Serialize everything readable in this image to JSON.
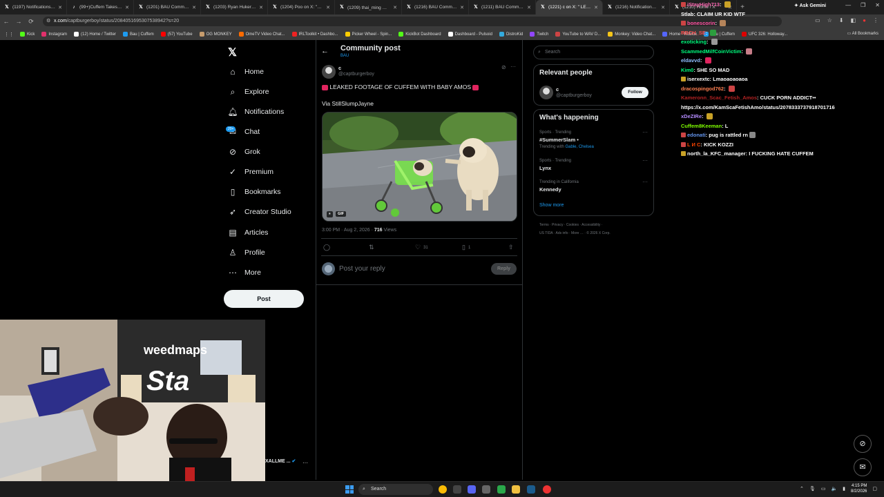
{
  "browser": {
    "tabs": [
      {
        "title": "(1197) Notifications / X",
        "icon": "x-icon",
        "active": false
      },
      {
        "title": "(99+)Cuffem Takes Brea",
        "icon": "tiktok-icon",
        "active": false
      },
      {
        "title": "(1201) BAU Community",
        "icon": "x-icon",
        "active": false
      },
      {
        "title": "(1203) Ryan Hukery on",
        "icon": "x-icon",
        "active": false
      },
      {
        "title": "(1204) Poo on X: \"http",
        "icon": "x-icon",
        "active": false
      },
      {
        "title": "(1209) thai_ming 🍋 on",
        "icon": "x-icon",
        "active": false
      },
      {
        "title": "(1216) BAU Community",
        "icon": "x-icon",
        "active": false
      },
      {
        "title": "(1211) BAU Community",
        "icon": "x-icon",
        "active": false
      },
      {
        "title": "(1221) c on X: \" LEAK",
        "icon": "x-icon",
        "active": true
      },
      {
        "title": "(1216) Notifications / X",
        "icon": "x-icon",
        "active": false
      },
      {
        "title": "(1210) Home / X",
        "icon": "x-icon",
        "active": false
      }
    ],
    "new_tab": "+",
    "ask_gemini": "Ask Gemini",
    "url_host": "x.com",
    "url_path": "/captburgerboy/status/2084051695307538942?s=20",
    "bookmarks": [
      {
        "label": "Kick",
        "color": "#53fc18"
      },
      {
        "label": "Instagram",
        "color": "#e1306c"
      },
      {
        "label": "(12) Home / Twitter",
        "color": "#ffffff"
      },
      {
        "label": "Bau | Cuffem",
        "color": "#1d9bf0"
      },
      {
        "label": "(57) YouTube",
        "color": "#ff0000"
      },
      {
        "label": "OG MONKEY",
        "color": "#c69c6d"
      },
      {
        "label": "OmeTV Video Chat...",
        "color": "#ff6b00"
      },
      {
        "label": "IRLToolkit • Dashbo...",
        "color": "#e22"
      },
      {
        "label": "Picker Wheel - Spin...",
        "color": "#ffcc00"
      },
      {
        "label": "KickBot Dashboard",
        "color": "#53fc18"
      },
      {
        "label": "Dashboard - Pulsoid",
        "color": "#ffffff"
      },
      {
        "label": "DistroKid",
        "color": "#3ad"
      },
      {
        "label": "Twitch",
        "color": "#9146ff"
      },
      {
        "label": "YouTube to WAV D...",
        "color": "#c44"
      },
      {
        "label": "Monkey: Video Chat...",
        "color": "#f5c518"
      },
      {
        "label": "Home - Roblox",
        "color": "#5566ff"
      },
      {
        "label": "Bau | Cuffem",
        "color": "#1d9bf0"
      },
      {
        "label": "UFC 326: Holloway...",
        "color": "#d00"
      }
    ],
    "all_bookmarks": "All Bookmarks"
  },
  "sidebar": {
    "items": [
      {
        "label": "Home",
        "icon": "home-icon"
      },
      {
        "label": "Explore",
        "icon": "search-icon"
      },
      {
        "label": "Notifications",
        "icon": "bell-icon"
      },
      {
        "label": "Chat",
        "icon": "chat-icon"
      },
      {
        "label": "Grok",
        "icon": "grok-icon"
      },
      {
        "label": "Premium",
        "icon": "premium-icon"
      },
      {
        "label": "Bookmarks",
        "icon": "bookmark-icon"
      },
      {
        "label": "Creator Studio",
        "icon": "rocket-icon"
      },
      {
        "label": "Articles",
        "icon": "article-icon"
      },
      {
        "label": "Profile",
        "icon": "person-icon"
      },
      {
        "label": "More",
        "icon": "more-circle-icon"
      }
    ],
    "chat_badge": "20+",
    "post_label": "Post"
  },
  "header": {
    "title": "Community post",
    "subtitle": "BAU"
  },
  "post": {
    "author_name": "c",
    "author_handle": "@captburgerboy",
    "text": "LEAKED FOOTAGE OF CUFFEM WITH BABY AMOS",
    "via": "Via StillSlumpJayne",
    "media_badge": "GIF",
    "time": "3:00 PM · Aug 2, 2026 ·",
    "views_count": "716",
    "views_label": "Views",
    "likes": "31",
    "bookmarks": "1",
    "reply_placeholder": "Post your reply",
    "reply_button": "Reply"
  },
  "right": {
    "search_placeholder": "Search",
    "relevant_title": "Relevant people",
    "relevant_name": "c",
    "relevant_handle": "@captburgerboy",
    "follow_label": "Follow",
    "happening_title": "What's happening",
    "trends": [
      {
        "context": "Sports · Trending",
        "name": "#SummerSlam •",
        "with_prefix": "Trending with",
        "with_links": "Gable, Chelsea"
      },
      {
        "context": "Sports · Trending",
        "name": "Lynx",
        "with_prefix": "",
        "with_links": ""
      },
      {
        "context": "Trending in California",
        "name": "Kennedy",
        "with_prefix": "",
        "with_links": ""
      }
    ],
    "show_more": "Show more",
    "footer_line1": "Terms ·  Privacy ·  Cookies ·  Accessibility ·",
    "footer_line2": "US TIDA  ·  Ads info  ·  More …  ·  © 2026 X Corp."
  },
  "chat": {
    "lines": [
      {
        "user": "iStayHigh713",
        "user_color": "#ff69b4",
        "msg": "",
        "badge": "#c44",
        "emote": "#c9a227"
      },
      {
        "user": "Stlab",
        "user_color": "#ffffff",
        "msg": "CLAIM UR KID WTF",
        "badge": "",
        "emote": ""
      },
      {
        "user": "bonescorin",
        "user_color": "#ff4fa0",
        "msg": "",
        "badge": "#c44",
        "emote": "#b5845a"
      },
      {
        "user": "RBCH_SE",
        "user_color": "#ff4f4f",
        "msg": "",
        "badge": "",
        "emote": "#2c9e3e"
      },
      {
        "user": "exoticking",
        "user_color": "#00ff7f",
        "msg": "",
        "badge": "",
        "emote": "#999999"
      },
      {
        "user": "ScammedMilfCoinVictim",
        "user_color": "#00ff7f",
        "msg": "",
        "badge": "",
        "emote": "#c77d88"
      },
      {
        "user": "eldavvd",
        "user_color": "#8fbfff",
        "msg": "",
        "badge": "",
        "emote": "#e0245e"
      },
      {
        "user": "Kim0",
        "user_color": "#00ff7f",
        "msg": "SHE SO MAD",
        "badge": "",
        "emote": ""
      },
      {
        "user": "iserxextc",
        "user_color": "#ffffff",
        "msg": "Lmaoaoaoaoa",
        "badge": "#c9a227",
        "emote": ""
      },
      {
        "user": "dracospingod762",
        "user_color": "#ff7f50",
        "msg": "",
        "badge": "",
        "emote": "#c44"
      },
      {
        "user": "Kameronn_Scac_Fetish_Amos",
        "user_color": "#b22222",
        "msg": "CUCK PORN ADDICT••",
        "badge": "",
        "emote": ""
      },
      {
        "user": "",
        "user_color": "#ffffff",
        "msg": "https://x.com/KamScaFetishAmo/status/2078333737918701716",
        "badge": "",
        "emote": ""
      },
      {
        "user": "xDeZIRe",
        "user_color": "#b58cff",
        "msg": "",
        "badge": "",
        "emote": "#c9a227"
      },
      {
        "user": "Cuffem8Keeman",
        "user_color": "#7fff00",
        "msg": "L",
        "badge": "",
        "emote": ""
      },
      {
        "user": "edonati",
        "user_color": "#6495ed",
        "msg": "pug is rattled rn",
        "badge": "#c44",
        "emote": "#888"
      },
      {
        "user": "L И C",
        "user_color": "#ff4500",
        "msg": "KICK KOZZI",
        "badge": "#c44",
        "emote": ""
      },
      {
        "user": "north_la_KFC_manager",
        "user_color": "#ffffff",
        "msg": "I FUCKING HATE CUFFEM",
        "badge": "#c9a227",
        "emote": ""
      }
    ]
  },
  "webcam": {
    "brand": "weedmaps",
    "banner_text": "Sta",
    "overlay_name": "XALLME ..."
  },
  "taskbar": {
    "search_placeholder": "Search",
    "time": "4:15 PM",
    "date": "8/2/2026",
    "apps": [
      {
        "name": "chrome",
        "color": "#fbbc05"
      },
      {
        "name": "obs",
        "color": "#444"
      },
      {
        "name": "discord",
        "color": "#5865f2"
      },
      {
        "name": "media",
        "color": "#666"
      },
      {
        "name": "app-green",
        "color": "#2aa84a"
      },
      {
        "name": "folder",
        "color": "#f0c040"
      },
      {
        "name": "steam",
        "color": "#1b5b8c"
      },
      {
        "name": "chrome-2",
        "color": "#e33"
      }
    ]
  }
}
